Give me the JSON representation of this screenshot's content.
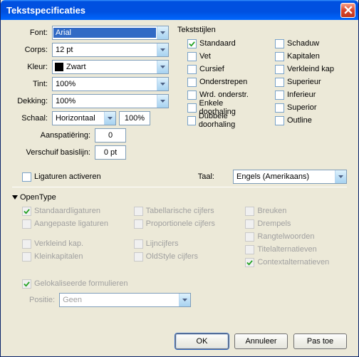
{
  "window": {
    "title": "Tekstspecificaties"
  },
  "font": {
    "label": "Font:",
    "value": "Arial",
    "corps_label": "Corps:",
    "corps_value": "12 pt",
    "kleur_label": "Kleur:",
    "kleur_value": "Zwart",
    "tint_label": "Tint:",
    "tint_value": "100%",
    "dekking_label": "Dekking:",
    "dekking_value": "100%",
    "schaal_label": "Schaal:",
    "schaal_dir": "Horizontaal",
    "schaal_value": "100%",
    "aanspatiering_label": "Aanspatiëring:",
    "aanspatiering_value": "0",
    "verschuif_label": "Verschuif basislijn:",
    "verschuif_value": "0 pt"
  },
  "tekststijlen": {
    "title": "Tekststijlen",
    "left": [
      {
        "label": "Standaard",
        "checked": true
      },
      {
        "label": "Vet",
        "checked": false
      },
      {
        "label": "Cursief",
        "checked": false
      },
      {
        "label": "Onderstrepen",
        "checked": false
      },
      {
        "label": "Wrd. onderstr.",
        "checked": false
      },
      {
        "label": "Enkele doorhaling",
        "checked": false
      },
      {
        "label": "Dubbele doorhaling",
        "checked": false
      }
    ],
    "right": [
      {
        "label": "Schaduw",
        "checked": false
      },
      {
        "label": "Kapitalen",
        "checked": false
      },
      {
        "label": "Verkleind kap",
        "checked": false
      },
      {
        "label": "Superieur",
        "checked": false
      },
      {
        "label": "Inferieur",
        "checked": false
      },
      {
        "label": "Superior",
        "checked": false
      },
      {
        "label": "Outline",
        "checked": false
      }
    ]
  },
  "extras": {
    "ligaturen_label": "Ligaturen activeren",
    "taal_label": "Taal:",
    "taal_value": "Engels (Amerikaans)"
  },
  "opentype": {
    "title": "OpenType",
    "col1a": [
      {
        "label": "Standaardligaturen",
        "checked": true,
        "disabled": true
      },
      {
        "label": "Aangepaste ligaturen",
        "checked": false,
        "disabled": true
      }
    ],
    "col1b": [
      {
        "label": "Verkleind kap.",
        "checked": false,
        "disabled": true
      },
      {
        "label": "Kleinkapitalen",
        "checked": false,
        "disabled": true
      }
    ],
    "col2a": [
      {
        "label": "Tabellarische cijfers",
        "checked": false,
        "disabled": true
      },
      {
        "label": "Proportionele cijfers",
        "checked": false,
        "disabled": true
      }
    ],
    "col2b": [
      {
        "label": "Lijncijfers",
        "checked": false,
        "disabled": true
      },
      {
        "label": "OldStyle cijfers",
        "checked": false,
        "disabled": true
      }
    ],
    "col3a": [
      {
        "label": "Breuken",
        "checked": false,
        "disabled": true
      },
      {
        "label": "Drempels",
        "checked": false,
        "disabled": true
      },
      {
        "label": "Rangtelwoorden",
        "checked": false,
        "disabled": true
      },
      {
        "label": "Titelalternatieven",
        "checked": false,
        "disabled": true
      },
      {
        "label": "Contextalternatieven",
        "checked": true,
        "disabled": true
      }
    ],
    "gelokaliseerde_label": "Gelokaliseerde formulieren",
    "positie_label": "Positie:",
    "positie_value": "Geen"
  },
  "buttons": {
    "ok": "OK",
    "annuleer": "Annuleer",
    "pastoe": "Pas toe"
  }
}
